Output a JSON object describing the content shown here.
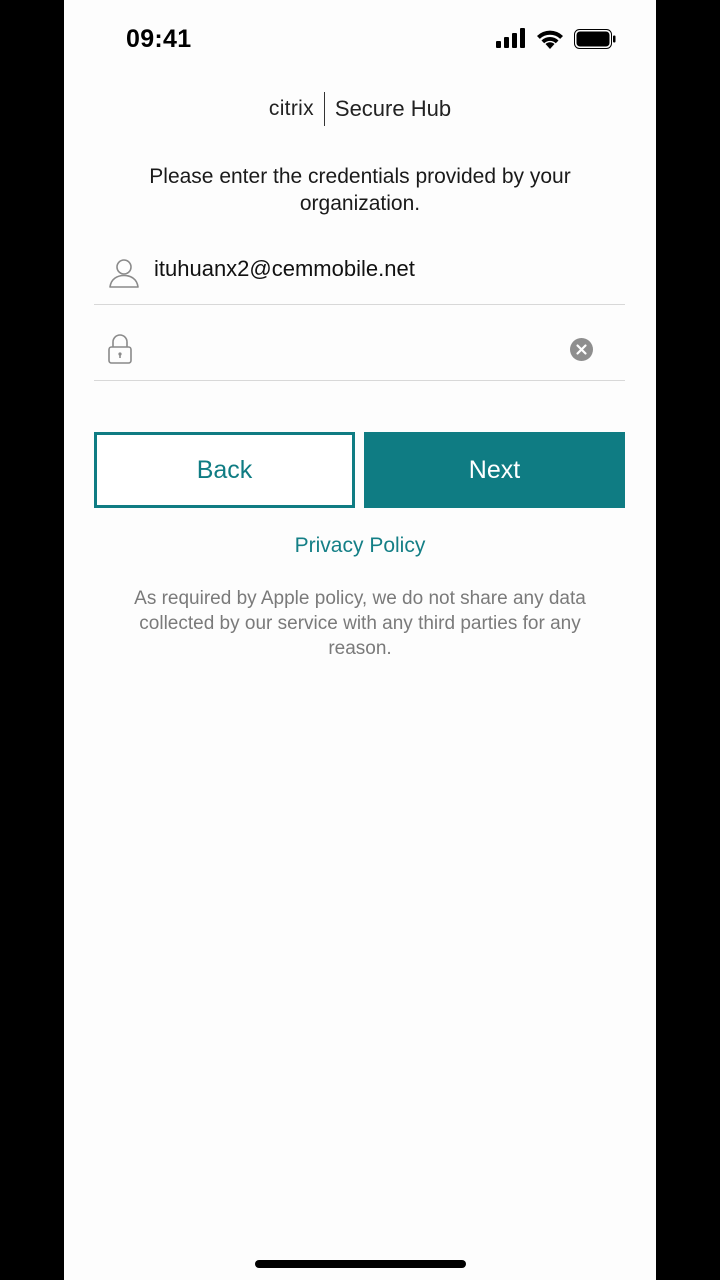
{
  "status_bar": {
    "time": "09:41"
  },
  "header": {
    "brand_logo": "citrix",
    "product_name": "Secure Hub"
  },
  "instructions": "Please enter the credentials provided by your organization.",
  "username_field": {
    "value": "ituhuanx2@cemmobile.net",
    "icon": "user-icon"
  },
  "password_field": {
    "value": "",
    "icon": "lock-icon",
    "clear_icon": "clear-icon"
  },
  "buttons": {
    "back_label": "Back",
    "next_label": "Next"
  },
  "privacy_policy_link": "Privacy Policy",
  "disclaimer": "As required by Apple policy, we do not share any data collected by our service with any third parties for any reason.",
  "colors": {
    "accent": "#0f7c83",
    "background": "#fdfdfd",
    "frame": "#000000",
    "muted_text": "#7a7a7a"
  }
}
